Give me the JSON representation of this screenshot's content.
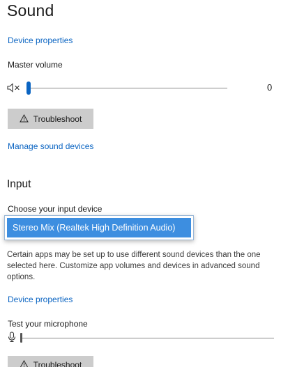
{
  "page": {
    "title": "Sound"
  },
  "output": {
    "device_properties_link": "Device properties",
    "master_volume_label": "Master volume",
    "volume_value": "0",
    "troubleshoot_label": "Troubleshoot",
    "manage_devices_link": "Manage sound devices",
    "volume_level": 0
  },
  "input": {
    "heading": "Input",
    "choose_device_label": "Choose your input device",
    "selected_device": "Stereo Mix (Realtek High Definition Audio)",
    "description": "Certain apps may be set up to use different sound devices than the one selected here. Customize app volumes and devices in advanced sound options.",
    "device_properties_link": "Device properties",
    "test_mic_label": "Test your microphone",
    "troubleshoot_label": "Troubleshoot",
    "mic_level": 0
  },
  "colors": {
    "accent": "#0a64c2",
    "selection": "#3d8ee0",
    "button_bg": "#cccccc"
  },
  "icons": {
    "speaker": "speaker-muted-icon",
    "warning": "warning-icon",
    "microphone": "microphone-icon"
  }
}
